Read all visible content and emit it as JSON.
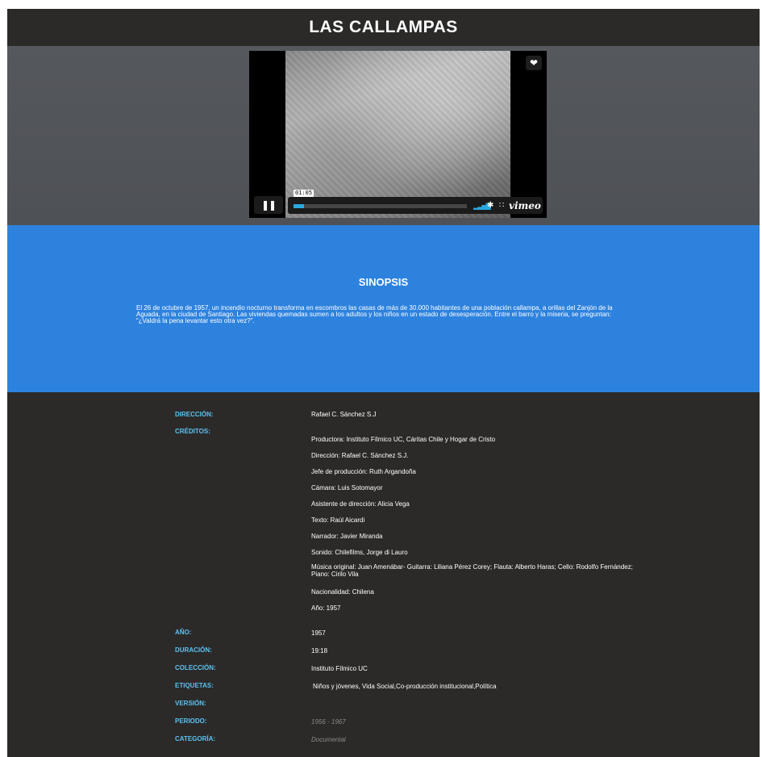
{
  "header": {
    "title": "LAS CALLAMPAS"
  },
  "player": {
    "timecode": "01:05",
    "progress": 0.06,
    "brand": "vimeo",
    "icons": [
      "heart-icon",
      "pause-icon",
      "volume-icon",
      "gear-icon",
      "fullscreen-icon"
    ],
    "accent_color": "#29a8e0"
  },
  "synopsis": {
    "title": "SINOPSIS",
    "text": "El 26 de octubre de 1957, un incendio nocturno transforma en escombros las casas de más de 30.000 habitantes de una población callampa, a orillas del Zanjón de la Aguada, en la ciudad de Santiago. Las viviendas quemadas sumen a los adultos y los niños en un estado de desesperación. Entre el barro y la miseria, se preguntan: “¿Valdrá la pena levantar esto otra vez?”."
  },
  "details": {
    "direccion_label": "DIRECCIÓN:",
    "direccion": "Rafael C. Sánchez S.J",
    "creditos_label": "CRÉDITOS:",
    "creditos": [
      "Productora: Instituto Fílmico UC, Cáritas Chile y Hogar de Cristo",
      "Dirección: Rafael C. Sánchez S.J.",
      "Jefe de producción: Ruth Argandoña",
      "Cámara: Luis Sotomayor",
      "Asistente de dirección: Alicia Vega",
      "Texto: Raúl Aicardi",
      "Narrador: Javier Miranda",
      "Sonido: Chilefilms, Jorge di Lauro",
      "Música original: Juan Amenábar- Guitarra: Liliana Pérez Corey; Flauta: Alberto Haras; Cello: Rodolfo Fernández; Piano: Cirilo Vila",
      "Nacionalidad: Chilena",
      "Año: 1957"
    ],
    "anio_label": "AÑO:",
    "anio": "1957",
    "duracion_label": "DURACIÓN:",
    "duracion": "19:18",
    "coleccion_label": "COLECCIÓN:",
    "coleccion": "Instituto Fílmico UC",
    "etiquetas_label": "ETIQUETAS:",
    "etiquetas": "Niños y jóvenes, Vida Social,Co-producción institucional,Política",
    "version_label": "VERSIÓN:",
    "periodo_label": "PERIODO:",
    "periodo": "1956 - 1967",
    "categoria_label": "CATEGORÍA:",
    "categoria": "Documental"
  }
}
